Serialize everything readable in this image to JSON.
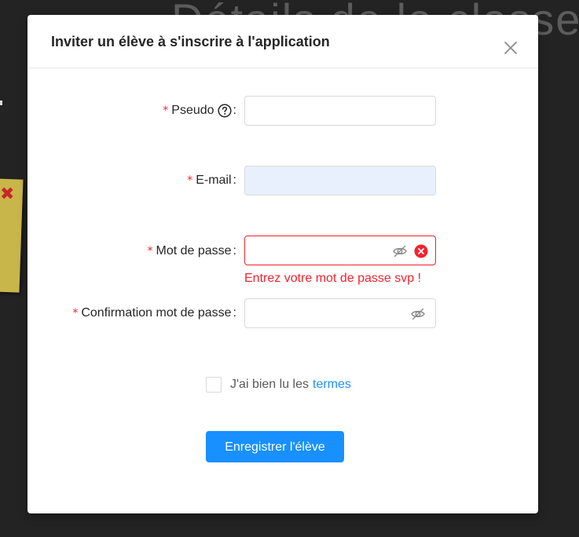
{
  "background": {
    "heading_text": "Détails de la classe"
  },
  "modal": {
    "title": "Inviter un élève à s'inscrire à l'application",
    "close_icon": "close-icon"
  },
  "form": {
    "pseudo": {
      "label": "Pseudo",
      "required_mark": "*",
      "help_icon": "question-circle-icon",
      "value": ""
    },
    "email": {
      "label": "E-mail",
      "required_mark": "*",
      "value": ""
    },
    "password": {
      "label": "Mot de passe",
      "required_mark": "*",
      "value": "",
      "error": "Entrez votre mot de passe svp !",
      "visibility_icon": "eye-invisible-icon",
      "status_icon": "close-circle-icon"
    },
    "confirm_password": {
      "label": "Confirmation mot de passe",
      "required_mark": "*",
      "value": "",
      "visibility_icon": "eye-invisible-icon"
    },
    "colon": ":",
    "terms": {
      "text": "J'ai bien lu les",
      "link": "termes",
      "checked": false
    },
    "submit_label": "Enregistrer l'élève"
  },
  "colors": {
    "primary": "#1890ff",
    "error": "#f5222d",
    "autofill_bg": "#e8f0fe",
    "backdrop": "#232323"
  }
}
